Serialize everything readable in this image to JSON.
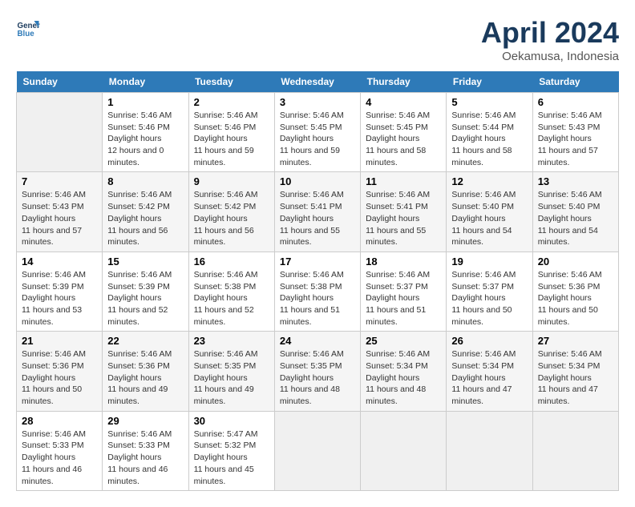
{
  "header": {
    "logo_line1": "General",
    "logo_line2": "Blue",
    "month": "April 2024",
    "location": "Oekamusa, Indonesia"
  },
  "weekdays": [
    "Sunday",
    "Monday",
    "Tuesday",
    "Wednesday",
    "Thursday",
    "Friday",
    "Saturday"
  ],
  "weeks": [
    [
      {
        "day": "",
        "empty": true
      },
      {
        "day": "1",
        "sunrise": "5:46 AM",
        "sunset": "5:46 PM",
        "daylight": "12 hours and 0 minutes."
      },
      {
        "day": "2",
        "sunrise": "5:46 AM",
        "sunset": "5:46 PM",
        "daylight": "11 hours and 59 minutes."
      },
      {
        "day": "3",
        "sunrise": "5:46 AM",
        "sunset": "5:45 PM",
        "daylight": "11 hours and 59 minutes."
      },
      {
        "day": "4",
        "sunrise": "5:46 AM",
        "sunset": "5:45 PM",
        "daylight": "11 hours and 58 minutes."
      },
      {
        "day": "5",
        "sunrise": "5:46 AM",
        "sunset": "5:44 PM",
        "daylight": "11 hours and 58 minutes."
      },
      {
        "day": "6",
        "sunrise": "5:46 AM",
        "sunset": "5:43 PM",
        "daylight": "11 hours and 57 minutes."
      }
    ],
    [
      {
        "day": "7",
        "sunrise": "5:46 AM",
        "sunset": "5:43 PM",
        "daylight": "11 hours and 57 minutes."
      },
      {
        "day": "8",
        "sunrise": "5:46 AM",
        "sunset": "5:42 PM",
        "daylight": "11 hours and 56 minutes."
      },
      {
        "day": "9",
        "sunrise": "5:46 AM",
        "sunset": "5:42 PM",
        "daylight": "11 hours and 56 minutes."
      },
      {
        "day": "10",
        "sunrise": "5:46 AM",
        "sunset": "5:41 PM",
        "daylight": "11 hours and 55 minutes."
      },
      {
        "day": "11",
        "sunrise": "5:46 AM",
        "sunset": "5:41 PM",
        "daylight": "11 hours and 55 minutes."
      },
      {
        "day": "12",
        "sunrise": "5:46 AM",
        "sunset": "5:40 PM",
        "daylight": "11 hours and 54 minutes."
      },
      {
        "day": "13",
        "sunrise": "5:46 AM",
        "sunset": "5:40 PM",
        "daylight": "11 hours and 54 minutes."
      }
    ],
    [
      {
        "day": "14",
        "sunrise": "5:46 AM",
        "sunset": "5:39 PM",
        "daylight": "11 hours and 53 minutes."
      },
      {
        "day": "15",
        "sunrise": "5:46 AM",
        "sunset": "5:39 PM",
        "daylight": "11 hours and 52 minutes."
      },
      {
        "day": "16",
        "sunrise": "5:46 AM",
        "sunset": "5:38 PM",
        "daylight": "11 hours and 52 minutes."
      },
      {
        "day": "17",
        "sunrise": "5:46 AM",
        "sunset": "5:38 PM",
        "daylight": "11 hours and 51 minutes."
      },
      {
        "day": "18",
        "sunrise": "5:46 AM",
        "sunset": "5:37 PM",
        "daylight": "11 hours and 51 minutes."
      },
      {
        "day": "19",
        "sunrise": "5:46 AM",
        "sunset": "5:37 PM",
        "daylight": "11 hours and 50 minutes."
      },
      {
        "day": "20",
        "sunrise": "5:46 AM",
        "sunset": "5:36 PM",
        "daylight": "11 hours and 50 minutes."
      }
    ],
    [
      {
        "day": "21",
        "sunrise": "5:46 AM",
        "sunset": "5:36 PM",
        "daylight": "11 hours and 50 minutes."
      },
      {
        "day": "22",
        "sunrise": "5:46 AM",
        "sunset": "5:36 PM",
        "daylight": "11 hours and 49 minutes."
      },
      {
        "day": "23",
        "sunrise": "5:46 AM",
        "sunset": "5:35 PM",
        "daylight": "11 hours and 49 minutes."
      },
      {
        "day": "24",
        "sunrise": "5:46 AM",
        "sunset": "5:35 PM",
        "daylight": "11 hours and 48 minutes."
      },
      {
        "day": "25",
        "sunrise": "5:46 AM",
        "sunset": "5:34 PM",
        "daylight": "11 hours and 48 minutes."
      },
      {
        "day": "26",
        "sunrise": "5:46 AM",
        "sunset": "5:34 PM",
        "daylight": "11 hours and 47 minutes."
      },
      {
        "day": "27",
        "sunrise": "5:46 AM",
        "sunset": "5:34 PM",
        "daylight": "11 hours and 47 minutes."
      }
    ],
    [
      {
        "day": "28",
        "sunrise": "5:46 AM",
        "sunset": "5:33 PM",
        "daylight": "11 hours and 46 minutes."
      },
      {
        "day": "29",
        "sunrise": "5:46 AM",
        "sunset": "5:33 PM",
        "daylight": "11 hours and 46 minutes."
      },
      {
        "day": "30",
        "sunrise": "5:47 AM",
        "sunset": "5:32 PM",
        "daylight": "11 hours and 45 minutes."
      },
      {
        "day": "",
        "empty": true
      },
      {
        "day": "",
        "empty": true
      },
      {
        "day": "",
        "empty": true
      },
      {
        "day": "",
        "empty": true
      }
    ]
  ]
}
